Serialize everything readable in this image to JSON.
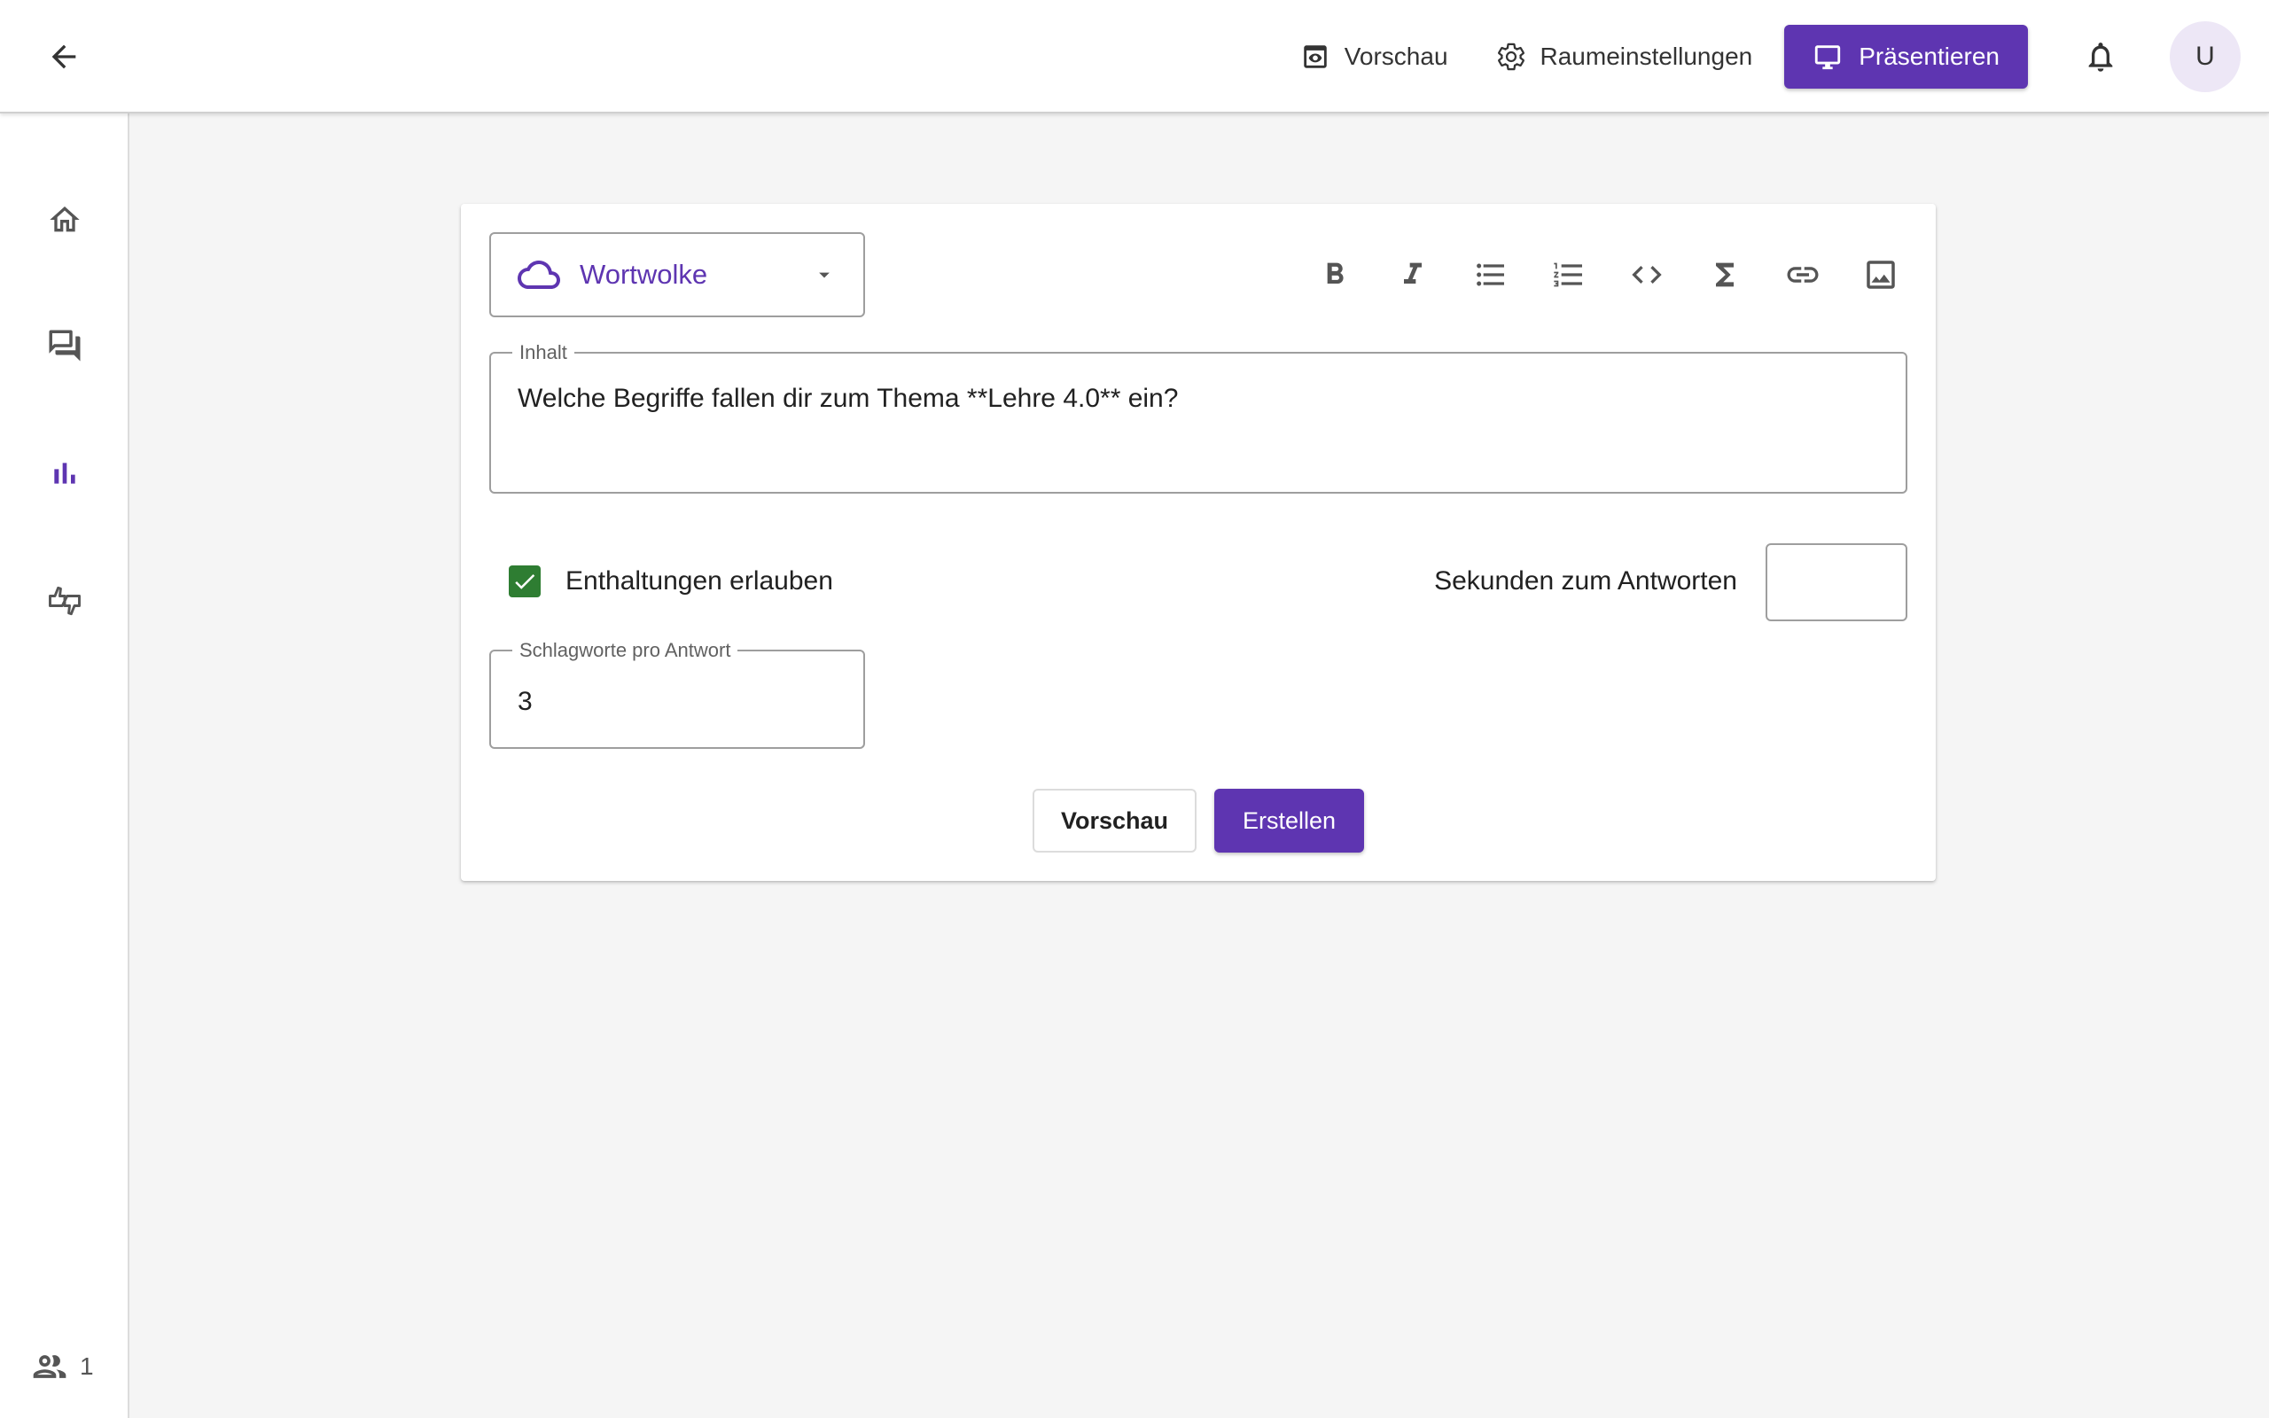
{
  "header": {
    "back_icon": "arrow-left-icon",
    "preview_label": "Vorschau",
    "settings_label": "Raumeinstellungen",
    "present_label": "Präsentieren",
    "avatar_initial": "U"
  },
  "sidebar": {
    "items": [
      {
        "name": "home",
        "icon": "home-icon",
        "active": false
      },
      {
        "name": "questions",
        "icon": "chat-icon",
        "active": false
      },
      {
        "name": "content",
        "icon": "bar-chart-icon",
        "active": true
      },
      {
        "name": "feedback",
        "icon": "thumbs-icon",
        "active": false
      }
    ],
    "user_count": "1"
  },
  "editor": {
    "type_label": "Wortwolke",
    "toolbar": [
      "bold-icon",
      "italic-icon",
      "bullet-list-icon",
      "numbered-list-icon",
      "code-icon",
      "sigma-icon",
      "link-icon",
      "image-icon"
    ],
    "content_label": "Inhalt",
    "content_value": "Welche Begriffe fallen dir zum Thema **Lehre 4.0** ein?",
    "abstentions_label": "Enthaltungen erlauben",
    "abstentions_checked": true,
    "seconds_label": "Sekunden zum Antworten",
    "seconds_value": "",
    "keywords_label": "Schlagworte pro Antwort",
    "keywords_value": "3",
    "preview_button": "Vorschau",
    "create_button": "Erstellen"
  },
  "colors": {
    "primary": "#5e35b1",
    "checkbox": "#2e7d32",
    "background": "#f5f5f5"
  }
}
